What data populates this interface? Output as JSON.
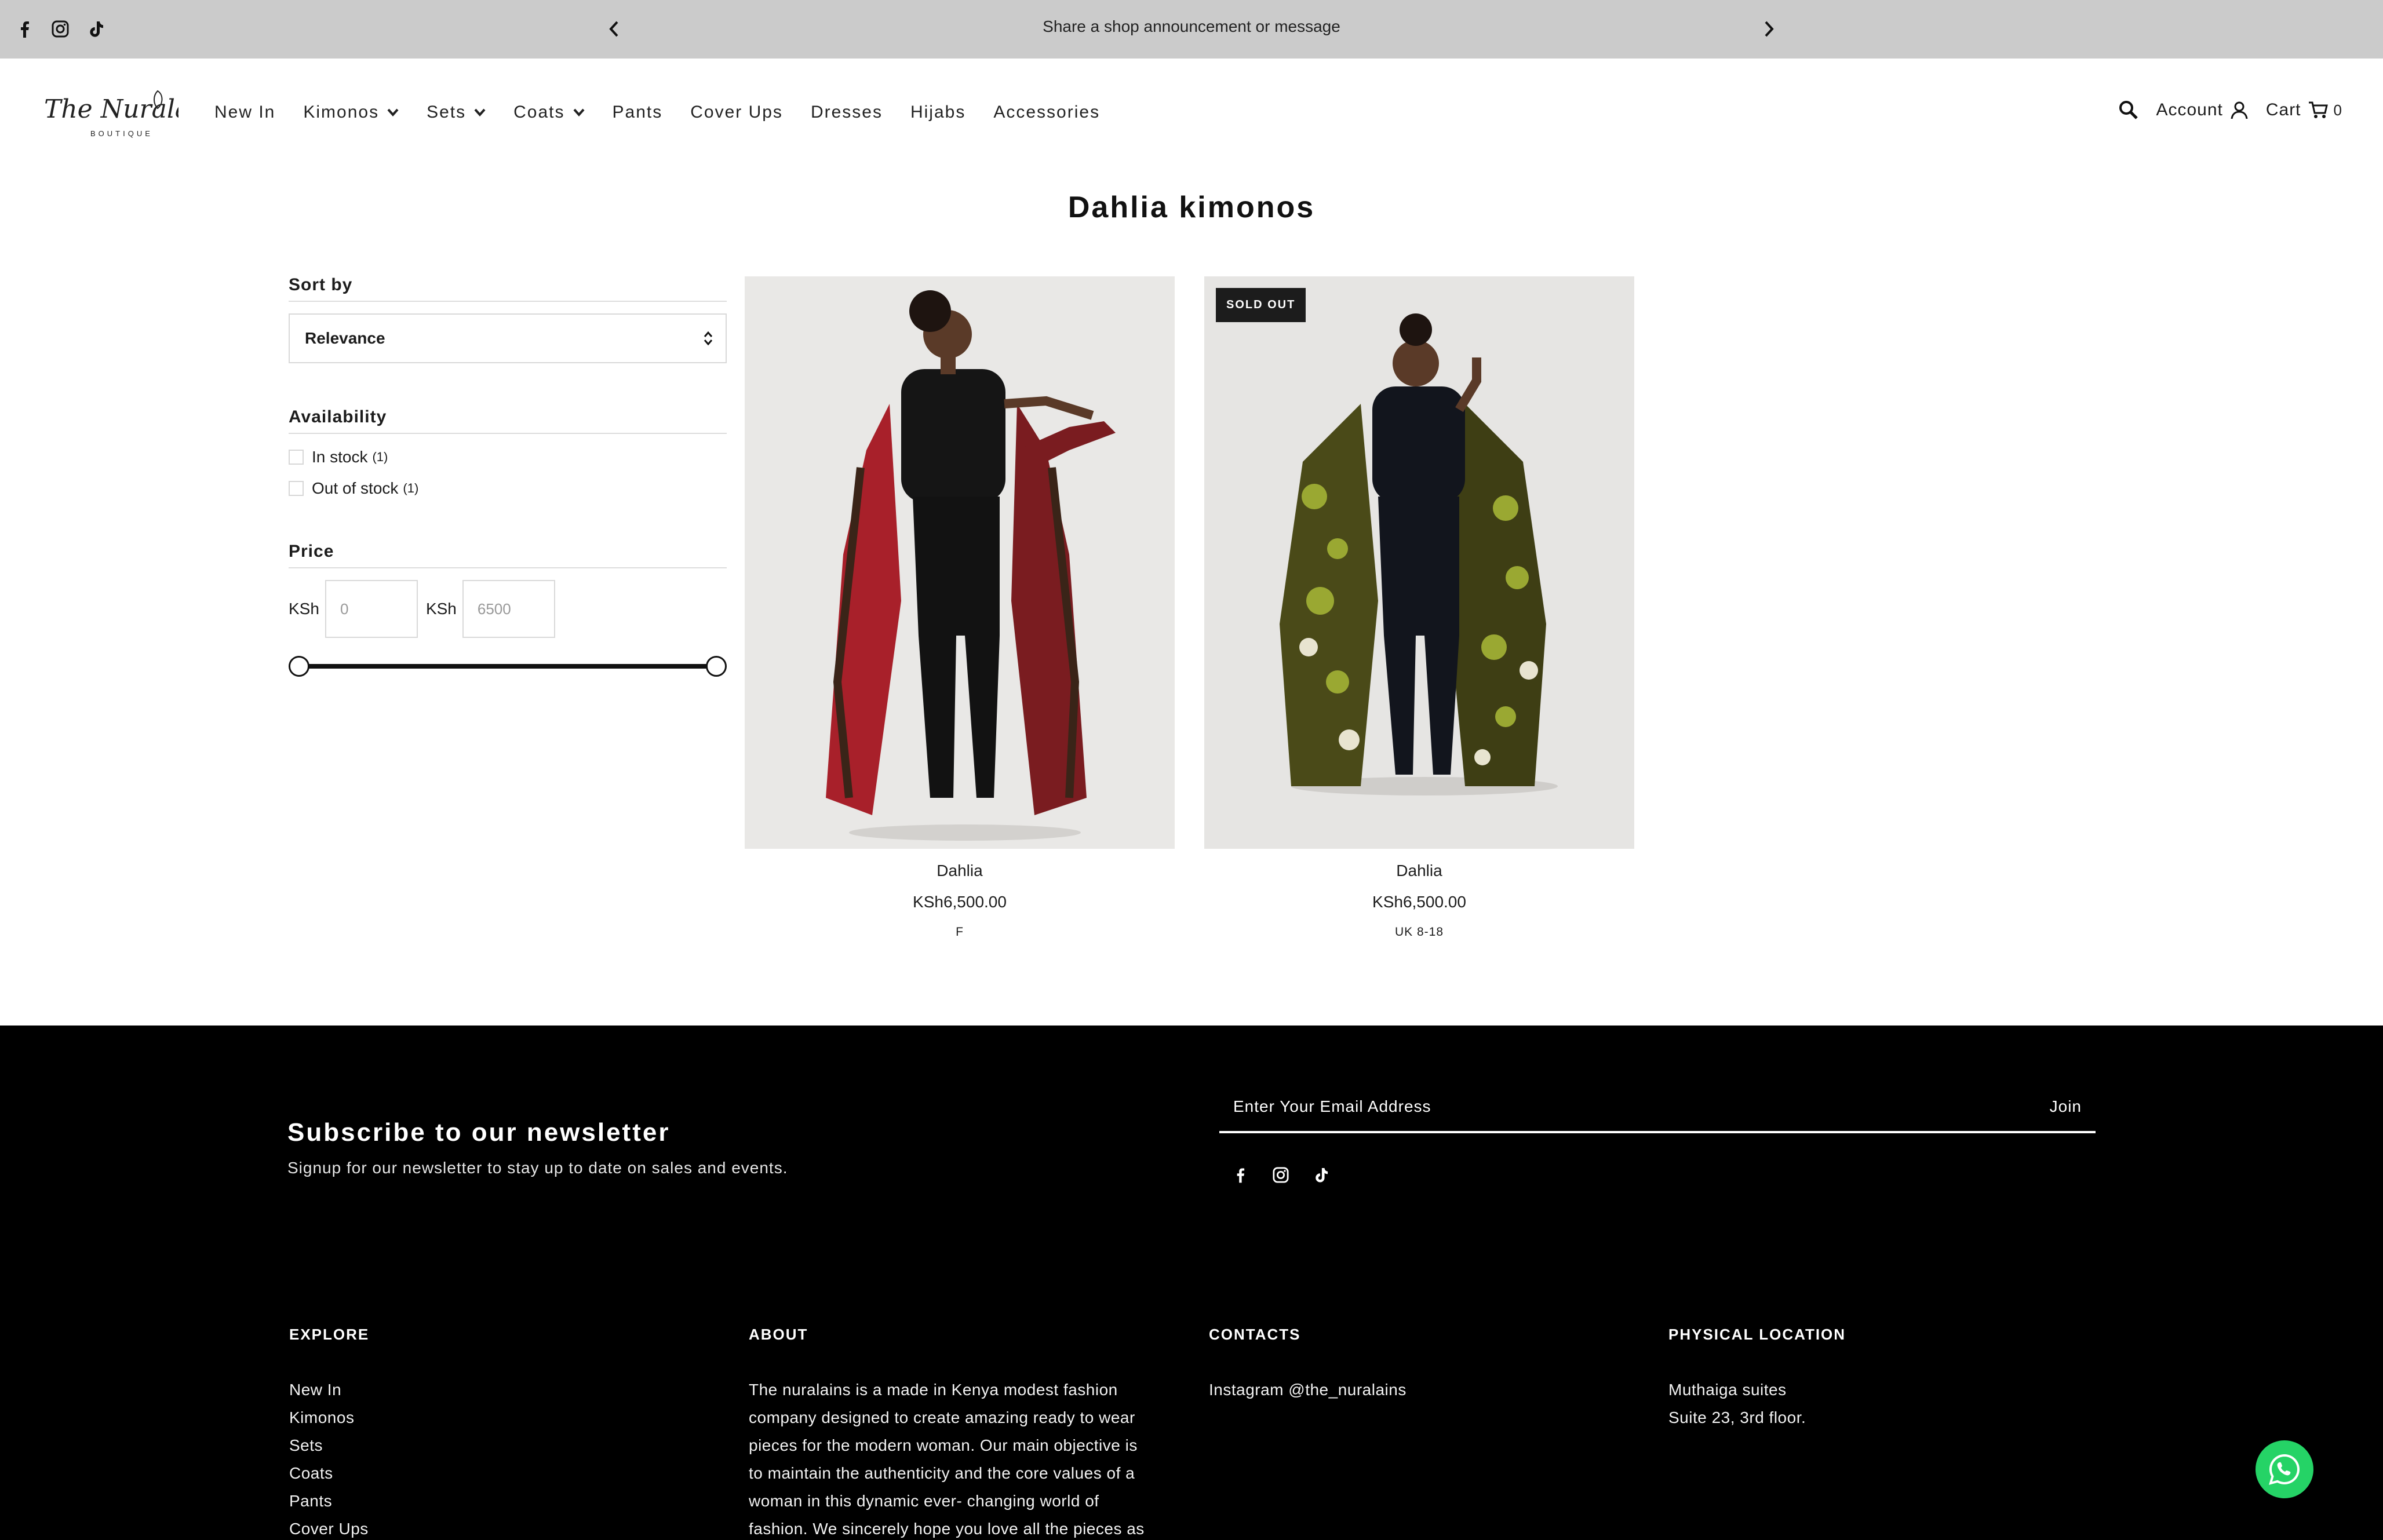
{
  "announcement": {
    "message": "Share a shop announcement or message",
    "social_icons": [
      "facebook-icon",
      "instagram-icon",
      "tiktok-icon"
    ]
  },
  "header": {
    "logo_text": "The Nuralains",
    "logo_subtext": "BOUTIQUE",
    "nav": [
      {
        "label": "New In",
        "dropdown": false
      },
      {
        "label": "Kimonos",
        "dropdown": true
      },
      {
        "label": "Sets",
        "dropdown": true
      },
      {
        "label": "Coats",
        "dropdown": true
      },
      {
        "label": "Pants",
        "dropdown": false
      },
      {
        "label": "Cover Ups",
        "dropdown": false
      },
      {
        "label": "Dresses",
        "dropdown": false
      },
      {
        "label": "Hijabs",
        "dropdown": false
      },
      {
        "label": "Accessories",
        "dropdown": false
      }
    ],
    "account_label": "Account",
    "cart_label": "Cart",
    "cart_count": "0"
  },
  "page": {
    "title": "Dahlia kimonos"
  },
  "filters": {
    "sort_label": "Sort by",
    "sort_value": "Relevance",
    "availability_label": "Availability",
    "availability_options": [
      {
        "label": "In stock",
        "count": "(1)"
      },
      {
        "label": "Out of stock",
        "count": "(1)"
      }
    ],
    "price_label": "Price",
    "currency": "KSh",
    "price_min_placeholder": "0",
    "price_max_placeholder": "6500"
  },
  "products": [
    {
      "name": "Dahlia",
      "price": "KSh6,500.00",
      "size": "F",
      "badge": "",
      "colors": {
        "pattern": "#a8202a",
        "accent": "#3a2418"
      }
    },
    {
      "name": "Dahlia",
      "price": "KSh6,500.00",
      "size": "UK 8-18",
      "badge": "SOLD OUT",
      "colors": {
        "pattern": "#4a4a18",
        "accent": "#9aa832"
      }
    }
  ],
  "footer": {
    "newsletter_title": "Subscribe to our newsletter",
    "newsletter_sub": "Signup for our newsletter to stay up to date on sales and events.",
    "email_placeholder": "Enter Your Email Address",
    "join_label": "Join",
    "explore_title": "EXPLORE",
    "explore_links": [
      "New In",
      "Kimonos",
      "Sets",
      "Coats",
      "Pants",
      "Cover Ups"
    ],
    "about_title": "ABOUT",
    "about_lines": [
      "The nuralains is a made in Kenya modest fashion",
      "company designed to create amazing ready to wear",
      "pieces for the modern woman. Our main objective is",
      "to maintain the authenticity and the core values of a",
      "woman in this dynamic ever- changing world of",
      "fashion. We sincerely hope you love all the pieces as"
    ],
    "contacts_title": "CONTACTS",
    "contacts_lines": [
      "Instagram @the_nuralains"
    ],
    "location_title": "PHYSICAL LOCATION",
    "location_lines": [
      "Muthaiga suites",
      "Suite 23, 3rd floor."
    ]
  }
}
